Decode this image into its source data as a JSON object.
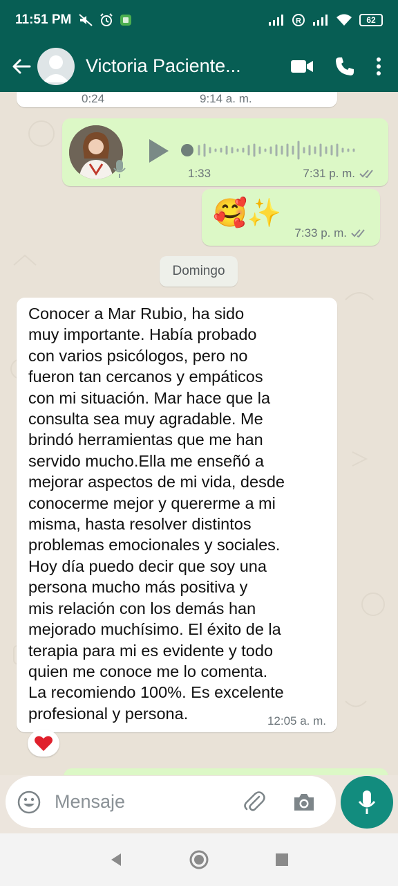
{
  "status_bar": {
    "time": "11:51 PM",
    "battery": "62"
  },
  "header": {
    "contact_name": "Victoria Paciente..."
  },
  "messages": {
    "prev_partial": {
      "duration": "0:24",
      "time": "9:14 a. m."
    },
    "voice_note": {
      "duration": "1:33",
      "time": "7:31 p. m.",
      "status": "read"
    },
    "emoji_message": {
      "text": "🥰✨",
      "time": "7:33 p. m."
    },
    "date_separator": "Domingo",
    "testimonial": {
      "text": "Conocer a Mar Rubio, ha sido\nmuy importante. Había probado\ncon varios psicólogos, pero no\nfueron tan cercanos y empáticos\ncon mi situación. Mar hace que la\nconsulta sea muy agradable. Me\nbrindó herramientas que me han\nservido mucho.Ella me enseñó a\nmejorar aspectos de mi vida, desde\nconocerme mejor y quererme a mi\nmisma, hasta resolver distintos\nproblemas emocionales y sociales.\nHoy día puedo decir que soy una\npersona mucho más positiva y\nmis relación con los demás han\nmejorado muchísimo. El éxito de la\nterapia para mi es evidente y todo\nquien me conoce me lo comenta.\nLa recomiendo 100%. Es excelente\nprofesional y persona.",
      "time": "12:05 a. m.",
      "reaction": "❤️"
    }
  },
  "input": {
    "placeholder": "Mensaje"
  },
  "colors": {
    "header": "#075e54",
    "outgoing_bubble": "#dcf8c6",
    "incoming_bubble": "#ffffff",
    "accent": "#128c7e",
    "chat_background": "#e9e2d7"
  },
  "icons": {
    "back": "arrow-left-icon",
    "video": "video-call-icon",
    "call": "phone-icon",
    "menu": "more-vertical-icon",
    "emoji": "emoji-icon",
    "attach": "paperclip-icon",
    "camera": "camera-icon",
    "mic": "microphone-icon"
  }
}
